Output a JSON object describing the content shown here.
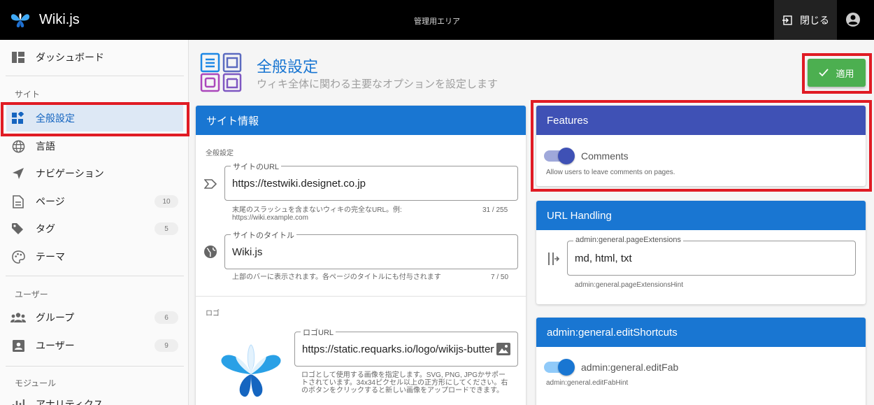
{
  "app": {
    "name": "Wiki.js",
    "area_title": "管理用エリア",
    "close_label": "閉じる"
  },
  "sidebar": {
    "dashboard": "ダッシュボード",
    "section_site": "サイト",
    "items_site": [
      {
        "label": "全般設定",
        "icon": "dashboard-tile-icon"
      },
      {
        "label": "言語",
        "icon": "globe-icon"
      },
      {
        "label": "ナビゲーション",
        "icon": "navigation-icon"
      },
      {
        "label": "ページ",
        "icon": "page-icon",
        "count": "10"
      },
      {
        "label": "タグ",
        "icon": "tag-icon",
        "count": "5"
      },
      {
        "label": "テーマ",
        "icon": "palette-icon"
      }
    ],
    "section_users": "ユーザー",
    "items_users": [
      {
        "label": "グループ",
        "icon": "group-icon",
        "count": "6"
      },
      {
        "label": "ユーザー",
        "icon": "user-card-icon",
        "count": "9"
      }
    ],
    "section_modules": "モジュール",
    "items_modules": [
      {
        "label": "アナリティクス"
      }
    ]
  },
  "header": {
    "title": "全般設定",
    "subtitle": "ウィキ全体に関わる主要なオプションを設定します",
    "apply_label": "適用"
  },
  "site_info": {
    "title": "サイト情報",
    "section_general": "全般設定",
    "url_legend": "サイトのURL",
    "url_value": "https://testwiki.designet.co.jp",
    "url_hint": "末尾のスラッシュを含まないウィキの完全なURL。例: https://wiki.example.com",
    "url_counter": "31 / 255",
    "title_legend": "サイトのタイトル",
    "title_value": "Wiki.js",
    "title_hint": "上部のバーに表示されます。各ページのタイトルにも付与されます",
    "title_counter": "7 / 50",
    "section_logo": "ロゴ",
    "logo_legend": "ロゴURL",
    "logo_value": "https://static.requarks.io/logo/wikijs-butterfly.svg",
    "logo_hint": "ロゴとして使用する画像を指定します。SVG, PNG, JPGかサポートされています。34x34ピクセル以上の正方形にしてください。右のボタンをクリックすると新しい画像をアップロードできます。"
  },
  "features": {
    "title": "Features",
    "comments_label": "Comments",
    "comments_enabled": true,
    "comments_hint": "Allow users to leave comments on pages."
  },
  "url_handling": {
    "title": "URL Handling",
    "legend": "admin:general.pageExtensions",
    "value": "md, html, txt",
    "hint": "admin:general.pageExtensionsHint"
  },
  "edit_shortcuts": {
    "title": "admin:general.editShortcuts",
    "fab_label": "admin:general.editFab",
    "fab_enabled": true,
    "fab_hint": "admin:general.editFabHint"
  },
  "colors": {
    "primary": "#1976d2",
    "indigo": "#3f51b5",
    "apply": "#4caf50",
    "highlight": "#e01b24"
  }
}
